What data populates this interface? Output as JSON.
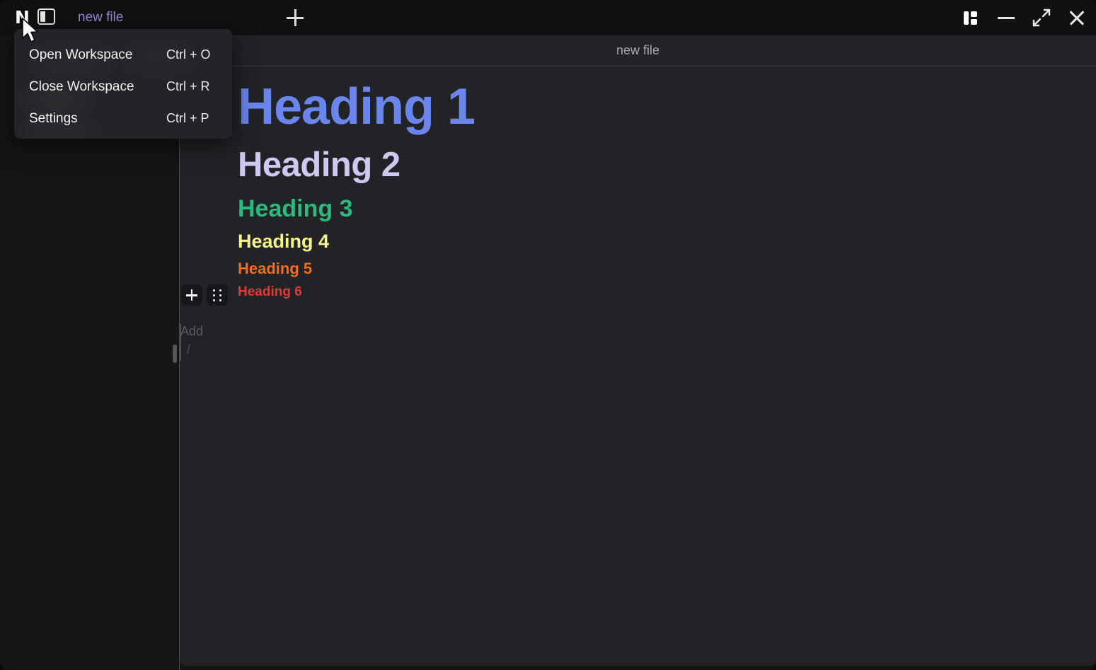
{
  "window": {
    "logo_glyph": "N",
    "controls": [
      {
        "name": "panel-layout",
        "label": "Toggle panel layout"
      },
      {
        "name": "minimize",
        "label": "Minimize"
      },
      {
        "name": "maximize",
        "label": "Maximize"
      },
      {
        "name": "close",
        "label": "Close"
      }
    ]
  },
  "tabs": [
    {
      "label": "new file",
      "active": true
    }
  ],
  "new_tab_label": "+",
  "menu": {
    "items": [
      {
        "label": "Open Workspace",
        "shortcut": "Ctrl + O"
      },
      {
        "label": "Close Workspace",
        "shortcut": "Ctrl + R"
      },
      {
        "label": "Settings",
        "shortcut": "Ctrl + P"
      }
    ]
  },
  "document": {
    "title": "new file",
    "blocks": [
      {
        "type": "heading1",
        "text": "Heading 1",
        "color": "#6a85ec"
      },
      {
        "type": "heading2",
        "text": "Heading 2",
        "color": "#cdc9f2"
      },
      {
        "type": "heading3",
        "text": "Heading 3",
        "color": "#2db87d"
      },
      {
        "type": "heading4",
        "text": "Heading 4",
        "color": "#f6f38a"
      },
      {
        "type": "heading5",
        "text": "Heading 5",
        "color": "#f26c1e"
      },
      {
        "type": "heading6",
        "text": "Heading 6",
        "color": "#e23b33"
      }
    ],
    "placeholder": {
      "add_label": "Add",
      "slash_hint": "/"
    }
  },
  "block_controls": {
    "add_label": "+",
    "drag_label": "Drag to move"
  },
  "colors": {
    "window_bg": "#141415",
    "titlebar_bg": "#111112",
    "sidebar_bg": "#151516",
    "editor_bg": "#222326",
    "menu_bg": "#232427",
    "divider": "#4a4a4e",
    "tab_accent": "#8f8ad8",
    "doc_title": "#a7a7a9"
  }
}
